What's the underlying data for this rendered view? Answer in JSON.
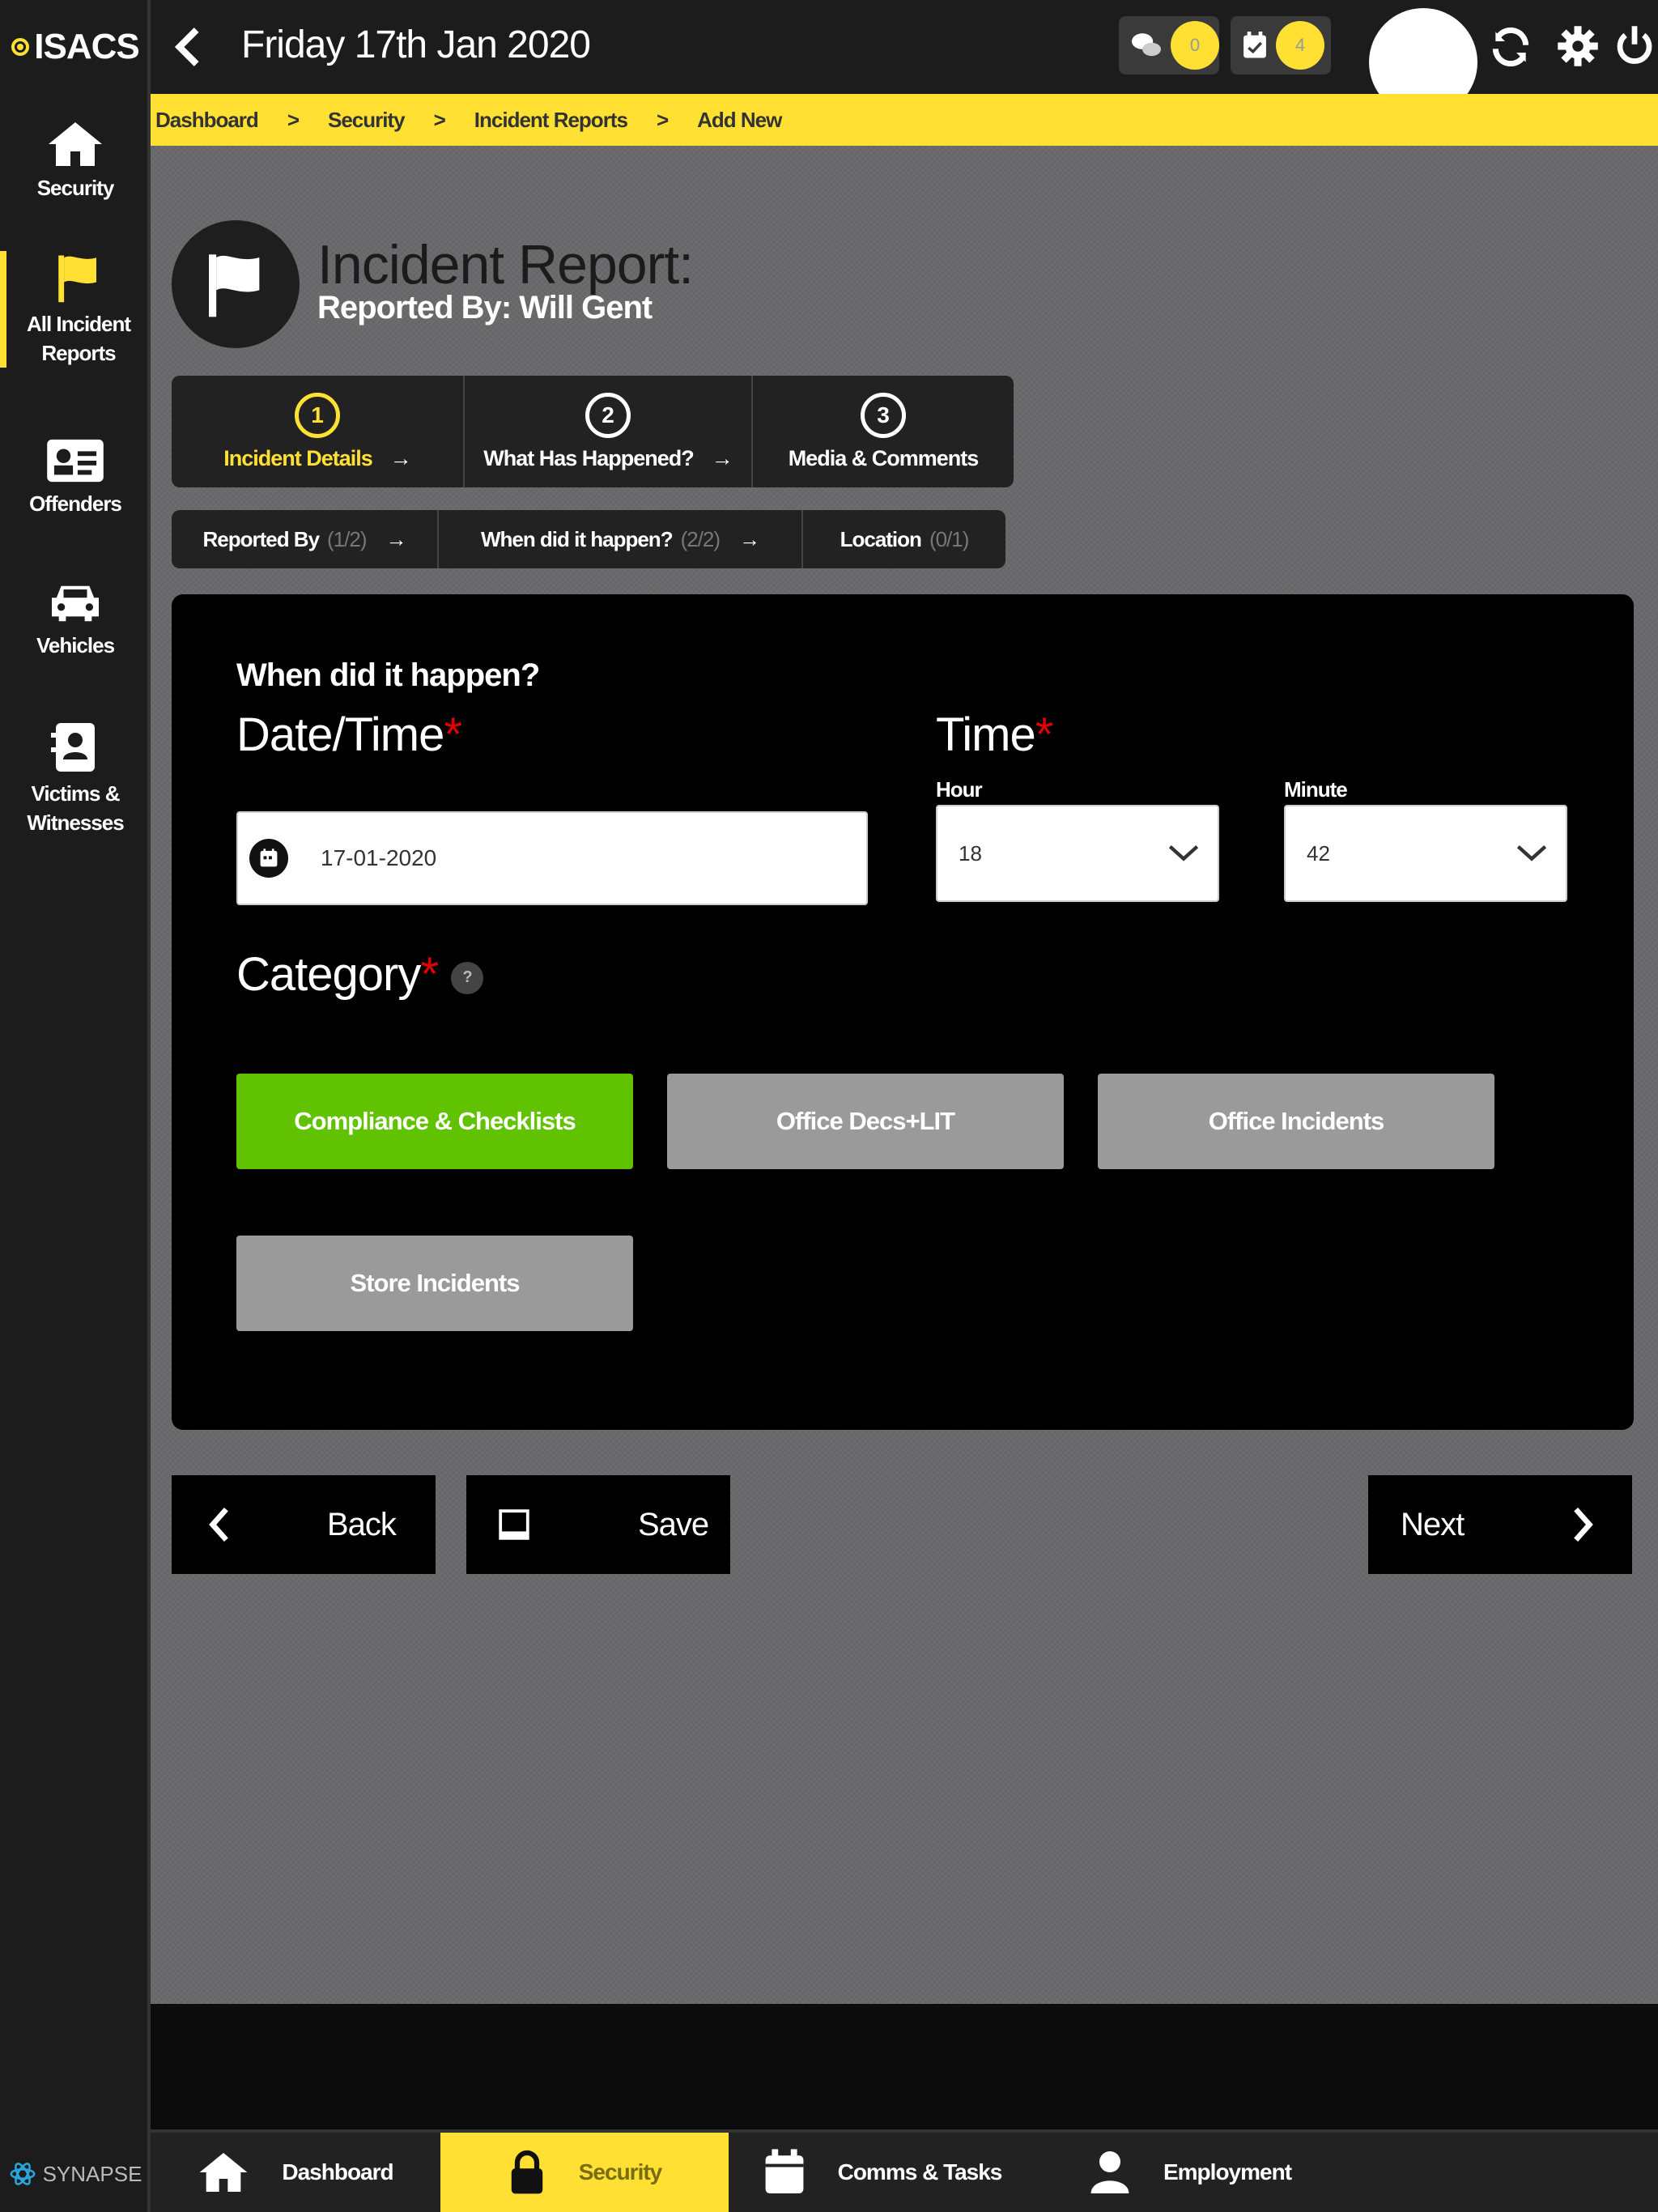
{
  "app": {
    "logo_text": "ISACS",
    "brand_footer": "SYNAPSE"
  },
  "colors": {
    "accent": "#ffe033",
    "selected": "#60c200",
    "unselected": "#9a9a9a",
    "required": "#e00000"
  },
  "header": {
    "date": "Friday 17th Jan 2020",
    "messages_count": "0",
    "tasks_count": "4"
  },
  "sidebar": {
    "items": [
      {
        "label": "Security",
        "icon": "home-icon"
      },
      {
        "label": "All Incident Reports",
        "icon": "flag-icon"
      },
      {
        "label": "Offenders",
        "icon": "id-card-icon"
      },
      {
        "label": "Vehicles",
        "icon": "car-icon"
      },
      {
        "label": "Victims & Witnesses",
        "icon": "contact-book-icon"
      }
    ]
  },
  "breadcrumb": [
    "Dashboard",
    "Security",
    "Incident Reports",
    "Add New"
  ],
  "page": {
    "title": "Incident Report:",
    "reported_by": "Reported By: Will Gent"
  },
  "steps": [
    {
      "num": "1",
      "label": "Incident Details"
    },
    {
      "num": "2",
      "label": "What Has Happened?"
    },
    {
      "num": "3",
      "label": "Media & Comments"
    }
  ],
  "substeps": [
    {
      "label": "Reported By",
      "count": "(1/2)"
    },
    {
      "label": "When did it happen?",
      "count": "(2/2)"
    },
    {
      "label": "Location",
      "count": "(0/1)"
    }
  ],
  "form": {
    "section_title": "When did it happen?",
    "date_label": "Date/Time",
    "date_value": "17-01-2020",
    "time_label": "Time",
    "hour_label": "Hour",
    "hour_value": "18",
    "minute_label": "Minute",
    "minute_value": "42",
    "category_label": "Category",
    "help_glyph": "?",
    "categories": [
      {
        "label": "Compliance & Checklists",
        "selected": true
      },
      {
        "label": "Office Decs+LIT",
        "selected": false
      },
      {
        "label": "Office Incidents",
        "selected": false
      },
      {
        "label": "Store Incidents",
        "selected": false
      }
    ]
  },
  "actions": {
    "back": "Back",
    "save": "Save",
    "next": "Next"
  },
  "bottom_nav": [
    {
      "label": "Dashboard",
      "icon": "home-icon"
    },
    {
      "label": "Security",
      "icon": "lock-icon"
    },
    {
      "label": "Comms & Tasks",
      "icon": "calendar-icon"
    },
    {
      "label": "Employment",
      "icon": "person-icon"
    }
  ]
}
